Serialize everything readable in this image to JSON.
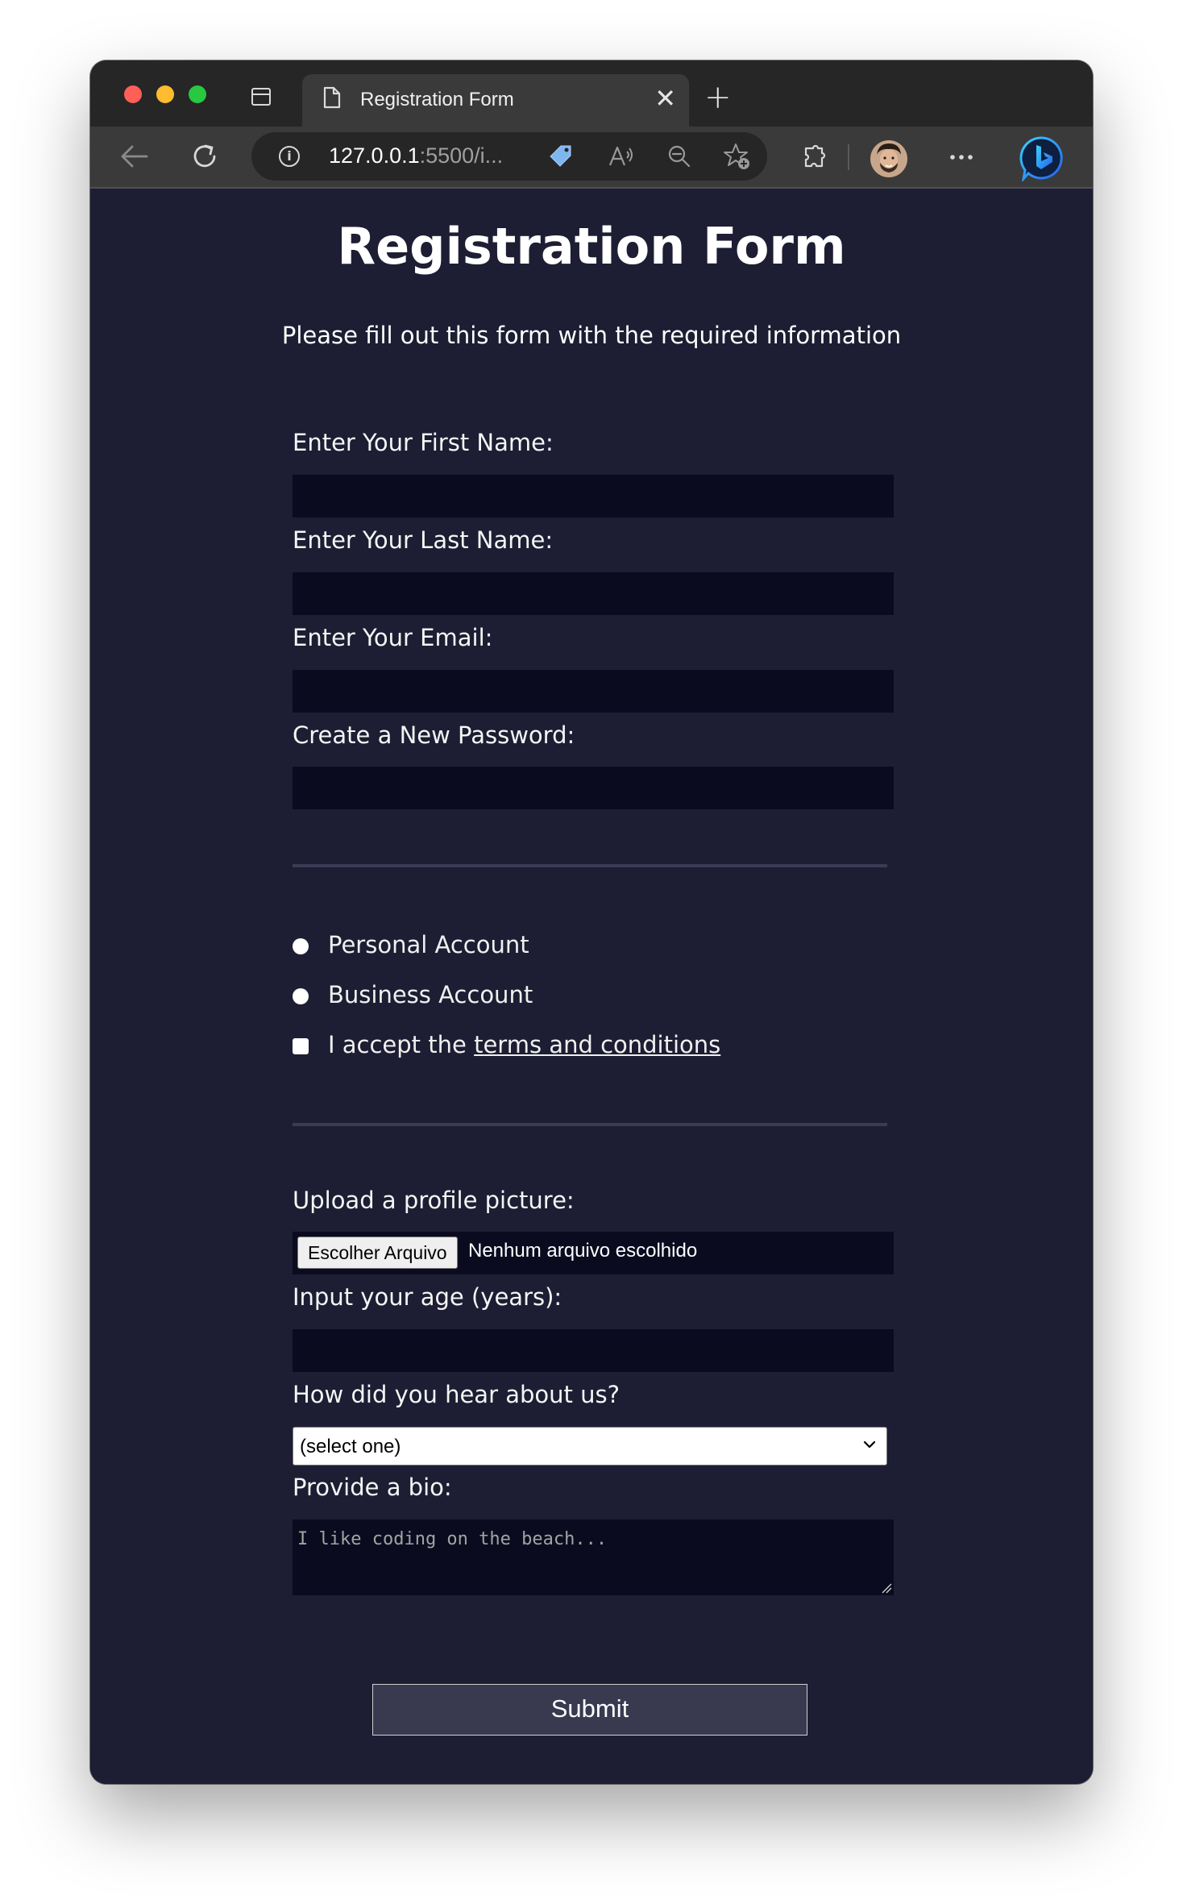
{
  "browser": {
    "tab_title": "Registration Form",
    "new_tab_symbol": "+",
    "url_host": "127.0.0.1",
    "url_rest": ":5500/i...",
    "icons": [
      "tabs-icon",
      "document-icon",
      "close-icon",
      "plus-icon",
      "back-arrow-icon",
      "reload-icon",
      "info-icon",
      "tag-icon",
      "read-aloud-icon",
      "zoom-out-icon",
      "favorite-add-icon",
      "extensions-icon",
      "avatar",
      "more-icon",
      "bing-icon"
    ]
  },
  "page": {
    "title": "Registration Form",
    "subtitle": "Please fill out this form with the required information"
  },
  "form": {
    "first_name_label": "Enter Your First Name:",
    "last_name_label": "Enter Your Last Name:",
    "email_label": "Enter Your Email:",
    "password_label": "Create a New Password:",
    "account_personal": "Personal Account",
    "account_business": "Business Account",
    "terms_prefix": "I accept the ",
    "terms_link": "terms and conditions",
    "upload_label": "Upload a profile picture:",
    "file_button": "Escolher Arquivo",
    "file_status": "Nenhum arquivo escolhido",
    "age_label": "Input your age (years):",
    "referrer_label": "How did you hear about us?",
    "referrer_selected": "(select one)",
    "bio_label": "Provide a bio:",
    "bio_placeholder": "I like coding on the beach...",
    "submit_label": "Submit"
  },
  "colors": {
    "page_bg": "#1d1d33",
    "input_bg": "#0b0b20",
    "submit_bg": "#393950"
  }
}
